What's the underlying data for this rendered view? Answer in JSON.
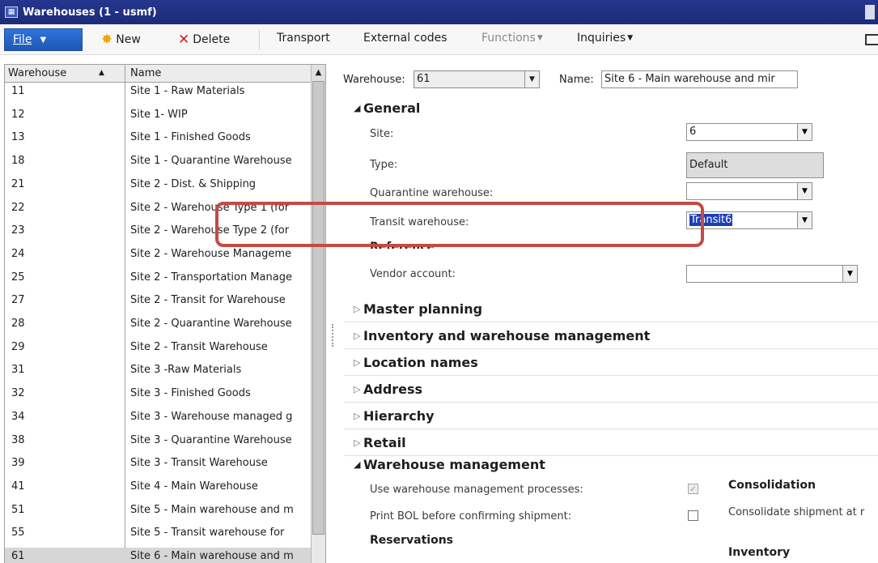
{
  "window": {
    "title": "Warehouses (1 - usmf)",
    "app_icon": "ax-icon"
  },
  "actions": {
    "file": "File",
    "new": "New",
    "delete": "Delete",
    "transport": "Transport",
    "external_codes": "External codes",
    "functions": "Functions",
    "inquiries": "Inquiries"
  },
  "grid": {
    "columns": [
      "Warehouse",
      "Name"
    ],
    "rows": [
      {
        "warehouse": "11",
        "name": "Site 1 - Raw Materials"
      },
      {
        "warehouse": "12",
        "name": "Site 1- WIP"
      },
      {
        "warehouse": "13",
        "name": "Site 1 - Finished Goods"
      },
      {
        "warehouse": "18",
        "name": "Site 1 - Quarantine Warehouse"
      },
      {
        "warehouse": "21",
        "name": "Site 2 - Dist. & Shipping"
      },
      {
        "warehouse": "22",
        "name": "Site 2 - Warehouse Type 1 (for"
      },
      {
        "warehouse": "23",
        "name": "Site 2 - Warehouse Type 2 (for"
      },
      {
        "warehouse": "24",
        "name": "Site 2 - Warehouse Manageme"
      },
      {
        "warehouse": "25",
        "name": "Site 2 - Transportation Manage"
      },
      {
        "warehouse": "27",
        "name": "Site 2 - Transit for Warehouse"
      },
      {
        "warehouse": "28",
        "name": "Site 2 - Quarantine Warehouse"
      },
      {
        "warehouse": "29",
        "name": "Site 2 - Transit Warehouse"
      },
      {
        "warehouse": "31",
        "name": "Site 3 -Raw Materials"
      },
      {
        "warehouse": "32",
        "name": "Site 3 - Finished Goods"
      },
      {
        "warehouse": "34",
        "name": "Site 3 - Warehouse managed g"
      },
      {
        "warehouse": "38",
        "name": "Site 3 - Quarantine Warehouse"
      },
      {
        "warehouse": "39",
        "name": "Site 3 - Transit Warehouse"
      },
      {
        "warehouse": "41",
        "name": "Site 4 - Main Warehouse"
      },
      {
        "warehouse": "51",
        "name": "Site 5 - Main warehouse and m"
      },
      {
        "warehouse": "55",
        "name": "Site 5 - Transit warehouse for"
      },
      {
        "warehouse": "61",
        "name": "Site 6 - Main warehouse and m"
      }
    ],
    "selected_index": 20
  },
  "header": {
    "warehouse_label": "Warehouse:",
    "warehouse_value": "61",
    "name_label": "Name:",
    "name_value": "Site 6 - Main warehouse and mir"
  },
  "general": {
    "title": "General",
    "site_label": "Site:",
    "site_value": "6",
    "type_label": "Type:",
    "type_value": "Default",
    "quarantine_label": "Quarantine warehouse:",
    "quarantine_value": "",
    "transit_label": "Transit warehouse:",
    "transit_value": "Transit6",
    "reference_heading": "Reference",
    "vendor_label": "Vendor account:",
    "vendor_value": ""
  },
  "fasttabs": [
    "Master planning",
    "Inventory and warehouse management",
    "Location names",
    "Address",
    "Hierarchy",
    "Retail"
  ],
  "wm": {
    "title": "Warehouse management",
    "use_wm_label": "Use warehouse management processes:",
    "use_wm_checked": true,
    "print_bol_label": "Print BOL before confirming shipment:",
    "print_bol_checked": false,
    "reservations_heading": "Reservations",
    "consolidation_heading": "Consolidation",
    "consolidate_label": "Consolidate shipment at r",
    "inventory_heading": "Inventory"
  },
  "colors": {
    "title_bar": "#1d2b7a",
    "file_button": "#1f57b5",
    "highlight": "#c44a45",
    "selection": "#1c3fb3"
  }
}
